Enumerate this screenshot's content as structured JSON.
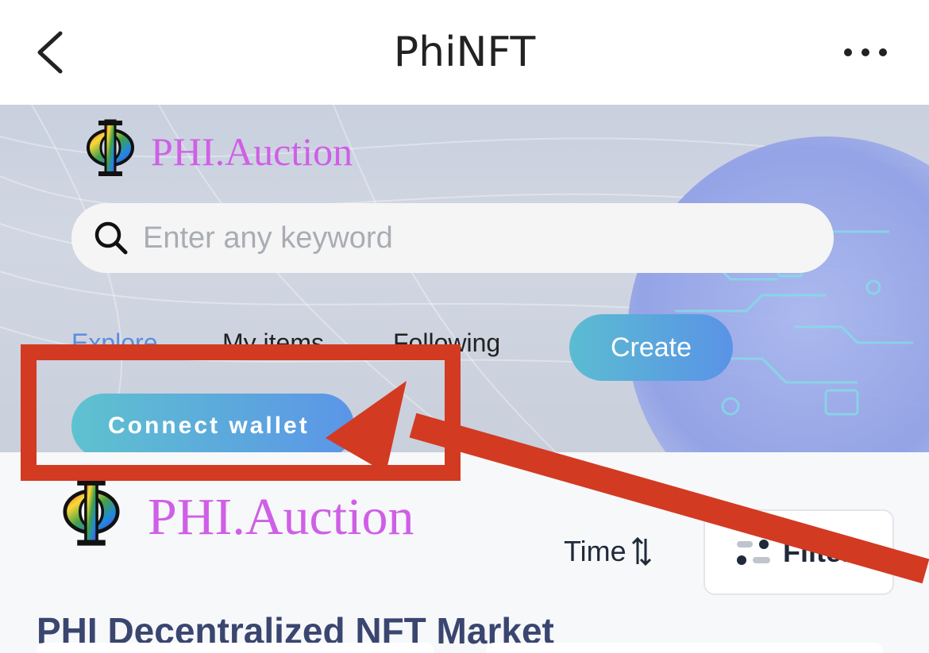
{
  "window": {
    "title": "PhiNFT",
    "back_icon": "chevron-left-icon",
    "more_icon": "more-horizontal-icon"
  },
  "hero": {
    "logo_text": "PHI.Auction",
    "search": {
      "placeholder": "Enter any keyword",
      "value": "",
      "icon": "search-icon"
    },
    "tabs": [
      {
        "label": "Explore",
        "active": true
      },
      {
        "label": "My items",
        "active": false
      },
      {
        "label": "Following",
        "active": false
      }
    ],
    "create_label": "Create",
    "connect_label": "Connect wallet"
  },
  "content": {
    "logo_text": "PHI.Auction",
    "sort_label": "Time",
    "sort_icon": "sort-arrows-icon",
    "filter_label": "Filter",
    "filter_icon": "filter-icon",
    "market_title": "PHI Decentralized NFT Market"
  },
  "colors": {
    "accent_blue": "#5a93e6",
    "accent_teal": "#5bbcd2",
    "logo_purple": "#cf5fe6",
    "annotation_red": "#d23a22"
  }
}
